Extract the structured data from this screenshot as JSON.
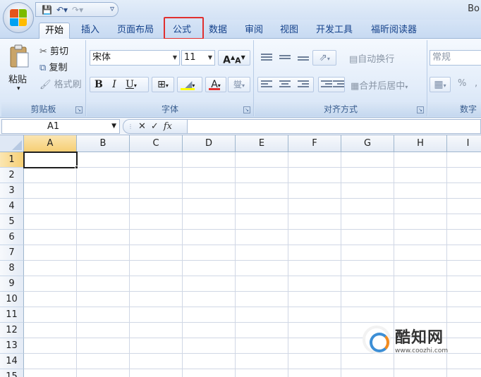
{
  "titlebar": {
    "doc_title": "Bo",
    "qat_more": "▿"
  },
  "tabs": [
    {
      "label": "开始",
      "active": true
    },
    {
      "label": "插入"
    },
    {
      "label": "页面布局"
    },
    {
      "label": "公式",
      "highlighted": true
    },
    {
      "label": "数据"
    },
    {
      "label": "审阅"
    },
    {
      "label": "视图"
    },
    {
      "label": "开发工具"
    },
    {
      "label": "福昕阅读器"
    }
  ],
  "ribbon": {
    "clipboard": {
      "label": "剪贴板",
      "paste": "粘贴",
      "cut": "剪切",
      "copy": "复制",
      "format_painter": "格式刷"
    },
    "font": {
      "label": "字体",
      "font_name": "宋体",
      "font_size": "11",
      "grow": "A",
      "shrink": "A",
      "bold": "B",
      "italic": "I",
      "underline": "U",
      "font_color_letter": "A",
      "phonetic": "燮"
    },
    "alignment": {
      "label": "对齐方式",
      "wrap_text": "自动换行",
      "merge_center": "合并后居中"
    },
    "number": {
      "label": "数字",
      "format": "常规",
      "percent": "%",
      "comma": ","
    }
  },
  "formula_bar": {
    "name_box": "A1",
    "cancel": "✕",
    "enter": "✓",
    "fx": "fx",
    "value": ""
  },
  "grid": {
    "columns": [
      "A",
      "B",
      "C",
      "D",
      "E",
      "F",
      "G",
      "H",
      "I"
    ],
    "rows": [
      "1",
      "2",
      "3",
      "4",
      "5",
      "6",
      "7",
      "8",
      "9",
      "10",
      "11",
      "12",
      "13",
      "14",
      "15"
    ],
    "active_cell": "A1"
  },
  "watermark": {
    "title": "酷知网",
    "url": "www.coozhi.com"
  },
  "colors": {
    "highlight_box": "#e0302f",
    "selection_header": "#f6cf74",
    "ribbon_text": "#15428b"
  }
}
